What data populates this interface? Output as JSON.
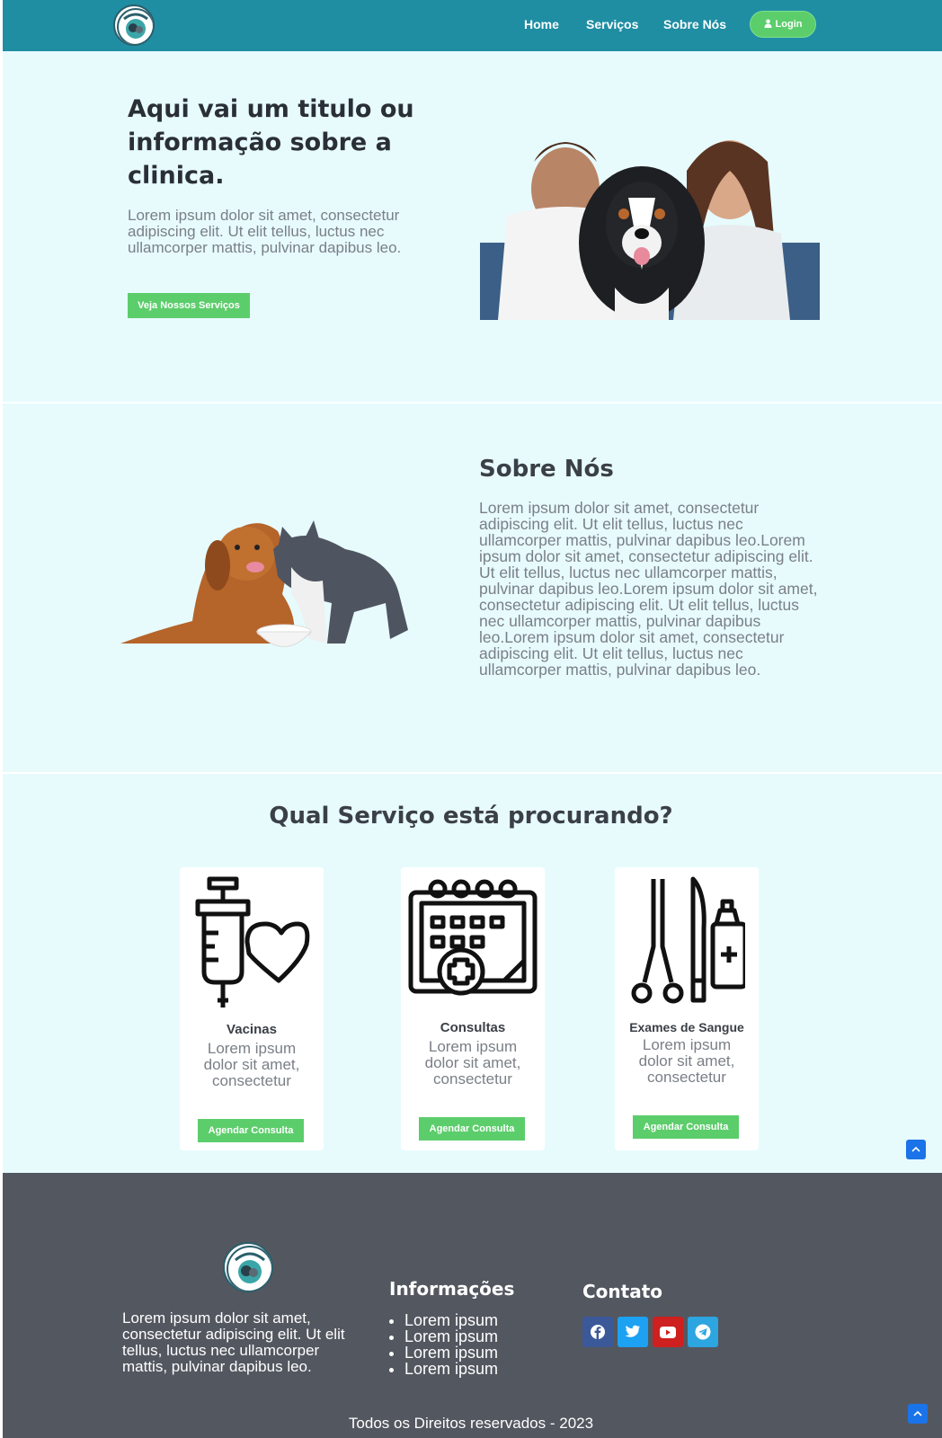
{
  "nav": {
    "items": [
      "Home",
      "Serviços",
      "Sobre Nós"
    ],
    "login_label": "Login"
  },
  "hero": {
    "title": "Aqui vai um titulo ou informação sobre a clinica.",
    "text": "Lorem ipsum dolor sit amet, consectetur adipiscing elit. Ut elit tellus, luctus nec ullamcorper mattis, pulvinar dapibus leo.",
    "button_label": "Veja Nossos Serviços"
  },
  "about": {
    "title": "Sobre Nós",
    "text": "Lorem ipsum dolor sit amet, consectetur adipiscing elit. Ut elit tellus, luctus nec ullamcorper mattis, pulvinar dapibus leo.Lorem ipsum dolor sit amet, consectetur adipiscing elit. Ut elit tellus, luctus nec ullamcorper mattis, pulvinar dapibus leo.Lorem ipsum dolor sit amet, consectetur adipiscing elit. Ut elit tellus, luctus nec ullamcorper mattis, pulvinar dapibus leo.Lorem ipsum dolor sit amet, consectetur adipiscing elit. Ut elit tellus, luctus nec ullamcorper mattis, pulvinar dapibus leo."
  },
  "services": {
    "title": "Qual Serviço está procurando?",
    "cards": [
      {
        "name": "Vacinas",
        "desc": "Lorem ipsum dolor sit amet, consectetur",
        "button_label": "Agendar Consulta",
        "icon": "syringe-heart-icon"
      },
      {
        "name": "Consultas",
        "desc": "Lorem ipsum dolor sit amet, consectetur",
        "button_label": "Agendar Consulta",
        "icon": "calendar-medical-icon"
      },
      {
        "name": "Exames de Sangue",
        "desc": "Lorem ipsum dolor sit amet, consectetur",
        "button_label": "Agendar Consulta",
        "icon": "medical-tools-icon"
      }
    ]
  },
  "footer": {
    "text": "Lorem ipsum dolor sit amet, consectetur adipiscing elit. Ut elit tellus, luctus nec ullamcorper mattis, pulvinar dapibus leo.",
    "info_title": "Informações",
    "info_items": [
      "Lorem ipsum",
      "Lorem ipsum",
      "Lorem ipsum",
      "Lorem ipsum"
    ],
    "contact_title": "Contato",
    "social": [
      {
        "icon": "facebook-icon",
        "color": "#3b5998"
      },
      {
        "icon": "twitter-icon",
        "color": "#1da1f2"
      },
      {
        "icon": "youtube-icon",
        "color": "#cd201f"
      },
      {
        "icon": "telegram-icon",
        "color": "#2ca5e0"
      }
    ],
    "copyright": "Todos os Direitos reservados - 2023"
  },
  "colors": {
    "header": "#1f8ea3",
    "accent_green": "#5ccd6b",
    "section_bg": "#e7fbfd",
    "footer_bg": "#535760"
  }
}
